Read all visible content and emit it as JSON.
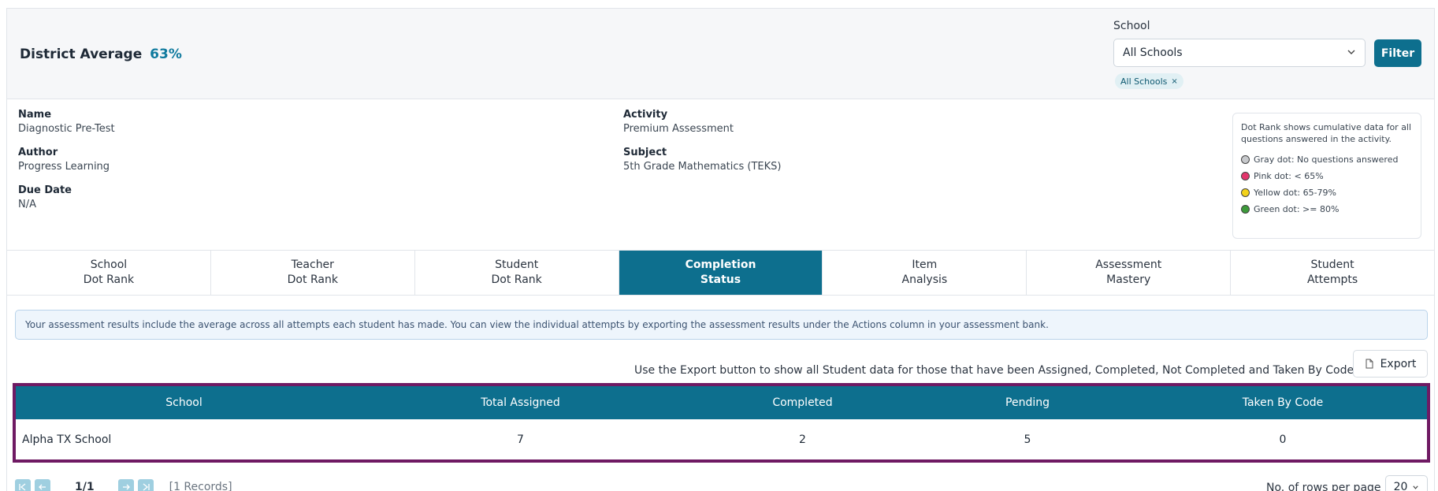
{
  "header": {
    "district_label": "District Average",
    "district_value": "63%",
    "school_label": "School",
    "school_selected": "All Schools",
    "filter_label": "Filter",
    "chip_label": "All Schools",
    "chip_close": "×"
  },
  "info": {
    "name_label": "Name",
    "name_value": "Diagnostic Pre-Test",
    "author_label": "Author",
    "author_value": "Progress Learning",
    "due_label": "Due Date",
    "due_value": "N/A",
    "activity_label": "Activity",
    "activity_value": "Premium Assessment",
    "subject_label": "Subject",
    "subject_value": "5th Grade Mathematics (TEKS)"
  },
  "legend": {
    "description": "Dot Rank shows cumulative data for all questions answered in the activity.",
    "items": [
      {
        "label": "Gray dot: No questions answered",
        "color": "#c7c9cc"
      },
      {
        "label": "Pink dot: < 65%",
        "color": "#e3356c"
      },
      {
        "label": "Yellow dot: 65-79%",
        "color": "#f2d21a"
      },
      {
        "label": "Green dot: >= 80%",
        "color": "#3d9a3a"
      }
    ]
  },
  "tabs": [
    {
      "line1": "School",
      "line2": "Dot Rank"
    },
    {
      "line1": "Teacher",
      "line2": "Dot Rank"
    },
    {
      "line1": "Student",
      "line2": "Dot Rank"
    },
    {
      "line1": "Completion",
      "line2": "Status",
      "active": true
    },
    {
      "line1": "Item",
      "line2": "Analysis"
    },
    {
      "line1": "Assessment",
      "line2": "Mastery"
    },
    {
      "line1": "Student",
      "line2": "Attempts"
    }
  ],
  "notice": "Your assessment results include the average across all attempts each student has made. You can view the individual attempts by exporting the assessment results under the Actions column in your assessment bank.",
  "export": {
    "hint": "Use the Export button to show all Student data for those that have been Assigned, Completed, Not Completed and Taken By Code.",
    "label": "Export"
  },
  "table": {
    "columns": [
      "School",
      "Total Assigned",
      "Completed",
      "Pending",
      "Taken By Code"
    ],
    "rows": [
      [
        "Alpha TX School",
        "7",
        "2",
        "5",
        "0"
      ]
    ]
  },
  "pagination": {
    "page": "1/1",
    "records": "[1 Records]",
    "rows_label": "No. of rows per page",
    "rows_value": "20"
  },
  "colors": {
    "primary": "#0d6f8e",
    "highlight_border": "#6f1a63",
    "accent_text": "#0f7a9e"
  }
}
